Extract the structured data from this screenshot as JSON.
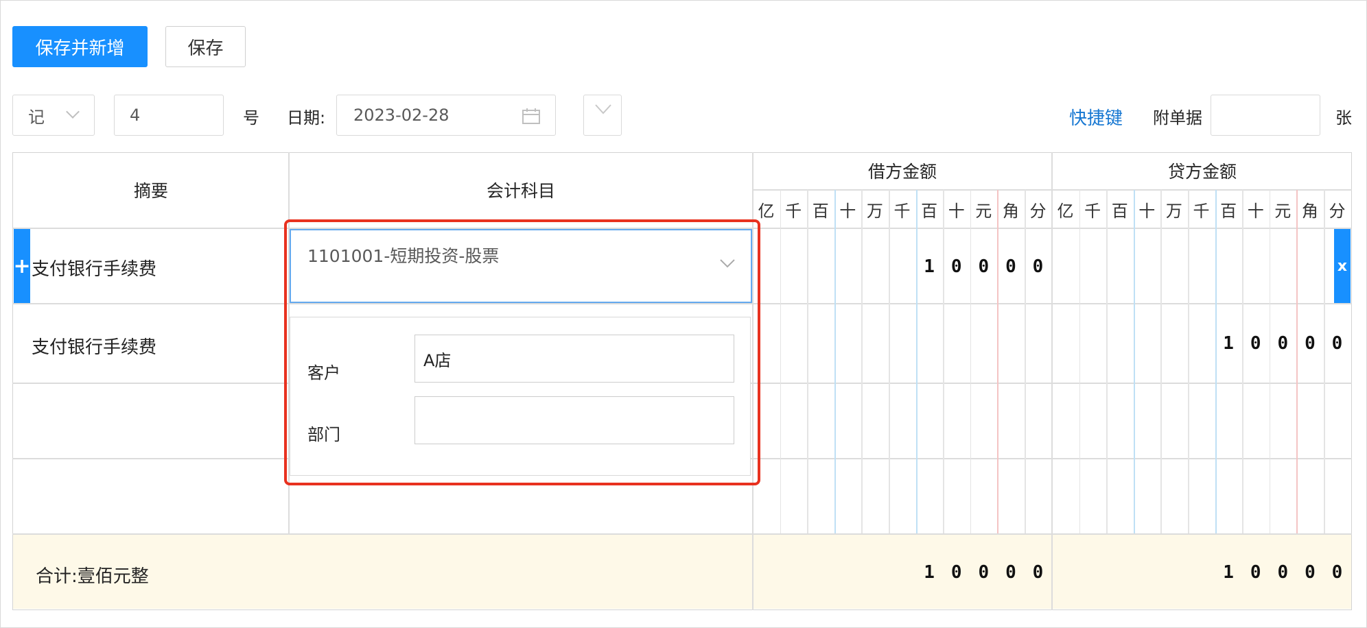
{
  "toolbar": {
    "save_new_label": "保存并新增",
    "save_label": "保存"
  },
  "header": {
    "voucher_type": "记",
    "voucher_number": "4",
    "number_suffix": "号",
    "date_label": "日期:",
    "date_value": "2023-02-28",
    "shortcut_label": "快捷键",
    "attach_label": "附单据",
    "attach_value": "",
    "attach_unit": "张"
  },
  "table": {
    "col_summary": "摘要",
    "col_subject": "会计科目",
    "col_debit": "借方金额",
    "col_credit": "贷方金额",
    "units": [
      "亿",
      "千",
      "百",
      "十",
      "万",
      "千",
      "百",
      "十",
      "元",
      "角",
      "分"
    ],
    "rows": [
      {
        "summary": "支付银行手续费",
        "subject": "1101001-短期投资-股票",
        "debit_digits": [
          "1",
          "0",
          "0",
          "0",
          "0"
        ],
        "credit_digits": []
      },
      {
        "summary": "支付银行手续费",
        "subject": "",
        "debit_digits": [],
        "credit_digits": [
          "1",
          "0",
          "0",
          "0",
          "0"
        ]
      },
      {
        "summary": "",
        "subject": "",
        "debit_digits": [],
        "credit_digits": []
      },
      {
        "summary": "",
        "subject": "",
        "debit_digits": [],
        "credit_digits": []
      }
    ],
    "total_label": "合计:壹佰元整",
    "total_debit_digits": [
      "1",
      "0",
      "0",
      "0",
      "0"
    ],
    "total_credit_digits": [
      "1",
      "0",
      "0",
      "0",
      "0"
    ],
    "add_row_symbol": "+",
    "delete_row_symbol": "x"
  },
  "aux_panel": {
    "customer_label": "客户",
    "customer_value": "A店",
    "department_label": "部门",
    "department_value": ""
  },
  "icons": {
    "dropdown": "chevron-down-icon",
    "calendar": "calendar-icon"
  },
  "colors": {
    "primary": "#1890ff",
    "link": "#1677d2",
    "highlight": "#e8311f",
    "total_bg": "#fef9e8"
  }
}
